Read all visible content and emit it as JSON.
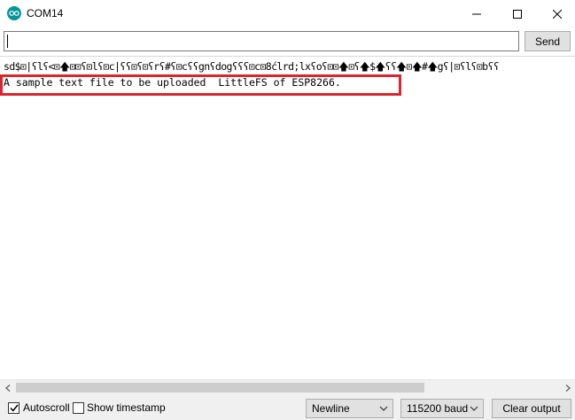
{
  "window": {
    "title": "COM14",
    "accent": "#00979c"
  },
  "send_row": {
    "input_value": "",
    "send_label": "Send"
  },
  "output": {
    "lines": [
      "sd$⊡|ʕlʕ<⊡🡅⊡⊡ʕ⊡lʕ⊡c|ʕʕ⊡ʕ⊡ʕrʕ#ʕ⊡cʕʕgnʕdogʕʕʕ⊡c⊡8ćlrd;lxʕoʕ⊡⊡🡅⊡ʕ🡅$🡅ʕʕ🡅⊡🡅#🡅gʕ|⊡ʕlʕ⊡bʕʕ",
      "A sample text file to be uploaded  LittleFS of ESP8266."
    ],
    "highlight_color": "#d9262e"
  },
  "bottom_bar": {
    "autoscroll_label": "Autoscroll",
    "autoscroll_checked": true,
    "timestamp_label": "Show timestamp",
    "timestamp_checked": false,
    "line_ending": "Newline",
    "baud_rate": "115200 baud",
    "clear_label": "Clear output"
  }
}
